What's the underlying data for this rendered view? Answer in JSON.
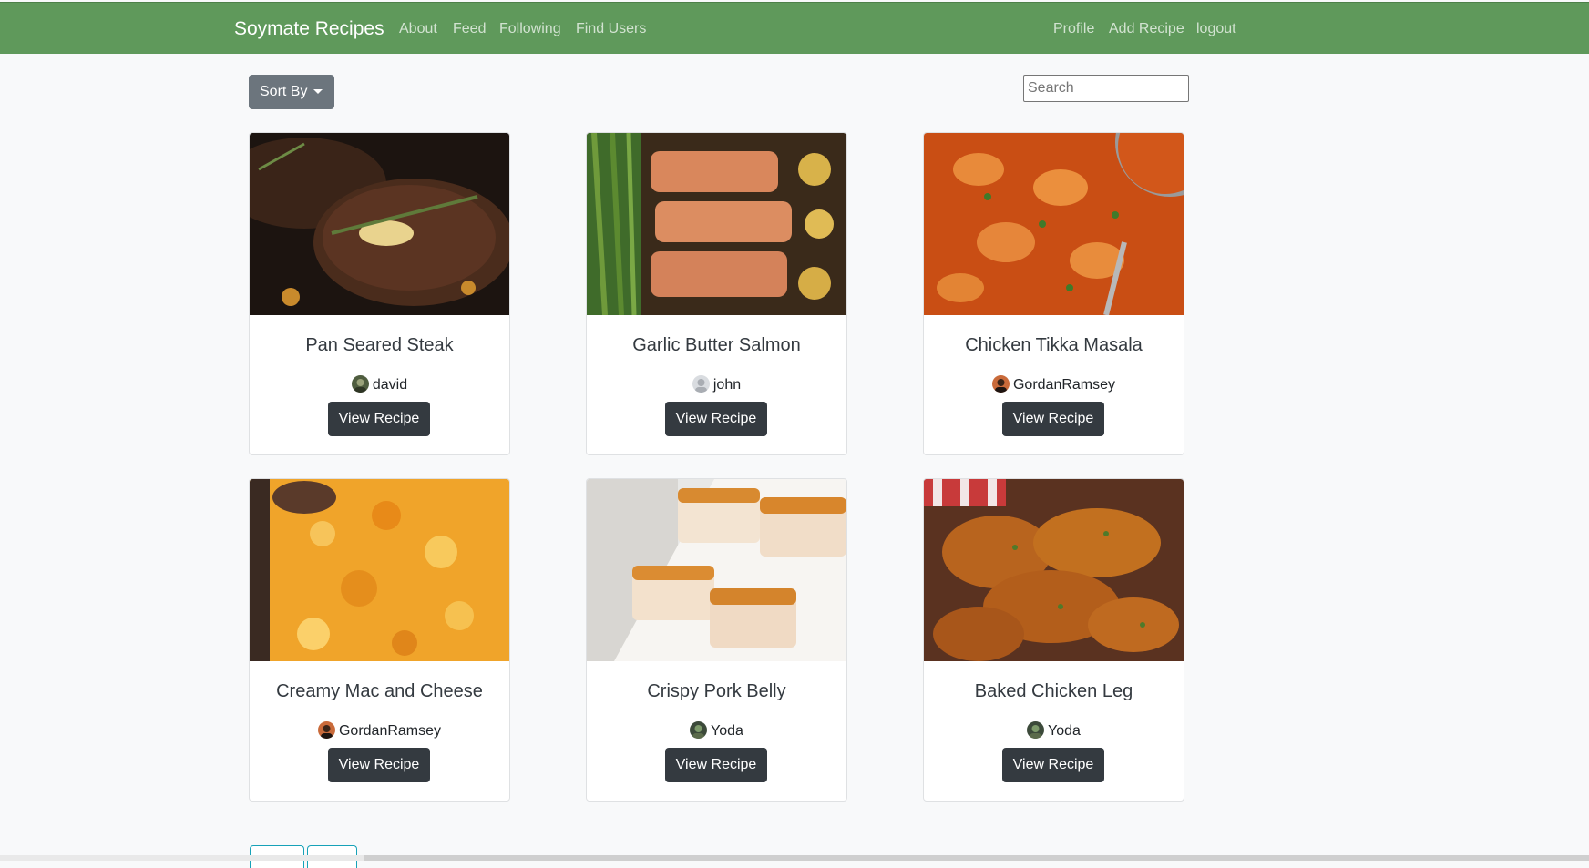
{
  "navbar": {
    "brand": "Soymate Recipes",
    "links_left": [
      "About",
      "Feed",
      "Following",
      "Find Users"
    ],
    "links_right": [
      "Profile",
      "Add Recipe",
      "logout"
    ],
    "color": "#5f995b"
  },
  "toolbar": {
    "sort_label": "Sort By",
    "search_placeholder": "Search"
  },
  "recipes": [
    {
      "title": "Pan Seared Steak",
      "author": "david",
      "button": "View Recipe"
    },
    {
      "title": "Garlic Butter Salmon",
      "author": "john",
      "button": "View Recipe"
    },
    {
      "title": "Chicken Tikka Masala",
      "author": "GordanRamsey",
      "button": "View Recipe"
    },
    {
      "title": "Creamy Mac and Cheese",
      "author": "GordanRamsey",
      "button": "View Recipe"
    },
    {
      "title": "Crispy Pork Belly",
      "author": "Yoda",
      "button": "View Recipe"
    },
    {
      "title": "Baked Chicken Leg",
      "author": "Yoda",
      "button": "View Recipe"
    }
  ]
}
